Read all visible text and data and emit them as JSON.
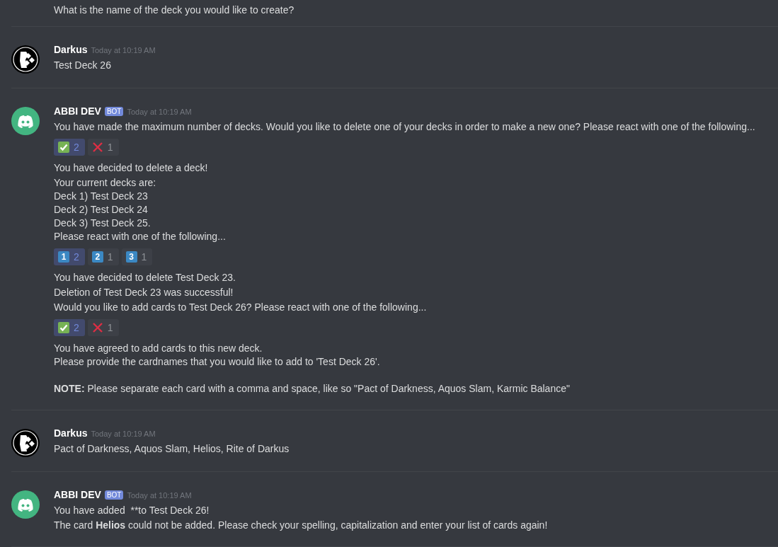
{
  "groups": [
    {
      "messages": [
        {
          "lines": [
            {
              "kind": "plain",
              "text": "What is the name of the deck you would like to create?"
            }
          ]
        }
      ]
    },
    {
      "author": {
        "name": "Darkus",
        "kind": "user",
        "timestamp": "Today at 10:19 AM"
      },
      "messages": [
        {
          "lines": [
            {
              "kind": "plain",
              "text": "Test Deck 26"
            }
          ]
        }
      ]
    },
    {
      "author": {
        "name": "ABBI DEV",
        "kind": "bot",
        "bot_tag": "BOT",
        "timestamp": "Today at 10:19 AM"
      },
      "messages": [
        {
          "lines": [
            {
              "kind": "plain",
              "text": "You have made the maximum number of decks. Would you like to delete one of your decks in order to make a new one? Please react with one of the following..."
            }
          ],
          "reactions": [
            {
              "kind": "check",
              "count": "2",
              "selected": true
            },
            {
              "kind": "cross",
              "count": "1",
              "selected": false
            }
          ]
        },
        {
          "lines": [
            {
              "kind": "plain",
              "text": "You have decided to delete a deck!"
            }
          ]
        },
        {
          "lines": [
            {
              "kind": "plain",
              "text": "Your current decks are:"
            },
            {
              "kind": "plain",
              "text": "Deck 1) Test Deck 23"
            },
            {
              "kind": "plain",
              "text": "Deck 2) Test Deck 24"
            },
            {
              "kind": "plain",
              "text": "Deck 3) Test Deck 25."
            },
            {
              "kind": "plain",
              "text": "Please react with one of the following..."
            }
          ],
          "reactions": [
            {
              "kind": "keycap",
              "digit": "1",
              "count": "2",
              "selected": true
            },
            {
              "kind": "keycap",
              "digit": "2",
              "count": "1",
              "selected": false
            },
            {
              "kind": "keycap",
              "digit": "3",
              "count": "1",
              "selected": false
            }
          ]
        },
        {
          "lines": [
            {
              "kind": "plain",
              "text": "You have decided to delete Test Deck 23."
            }
          ]
        },
        {
          "lines": [
            {
              "kind": "plain",
              "text": "Deletion of Test Deck 23 was successful!"
            }
          ]
        },
        {
          "lines": [
            {
              "kind": "plain",
              "text": "Would you like to add cards to Test Deck 26? Please react with one of the following..."
            }
          ],
          "reactions": [
            {
              "kind": "check",
              "count": "2",
              "selected": true
            },
            {
              "kind": "cross",
              "count": "1",
              "selected": false
            }
          ]
        },
        {
          "lines": [
            {
              "kind": "plain",
              "text": "You have agreed to add cards to this new deck."
            },
            {
              "kind": "plain",
              "text": "Please provide the cardnames that you would like to add to 'Test Deck 26'."
            },
            {
              "kind": "blank"
            },
            {
              "kind": "marked",
              "text": "**NOTE:** Please separate each card with a comma and space, like so \"Pact of Darkness, Aquos Slam, Karmic Balance\""
            }
          ]
        }
      ]
    },
    {
      "author": {
        "name": "Darkus",
        "kind": "user",
        "timestamp": "Today at 10:19 AM"
      },
      "messages": [
        {
          "lines": [
            {
              "kind": "plain",
              "text": "Pact of Darkness, Aquos Slam, Helios, Rite of Darkus"
            }
          ]
        }
      ]
    },
    {
      "author": {
        "name": "ABBI DEV",
        "kind": "bot",
        "bot_tag": "BOT",
        "timestamp": "Today at 10:19 AM"
      },
      "messages": [
        {
          "lines": [
            {
              "kind": "plain",
              "text": "You have added  **to Test Deck 26!"
            }
          ]
        },
        {
          "lines": [
            {
              "kind": "marked",
              "text": "The card **Helios** could not be added. Please check your spelling, capitalization and enter your list of cards again!"
            }
          ]
        }
      ]
    }
  ]
}
